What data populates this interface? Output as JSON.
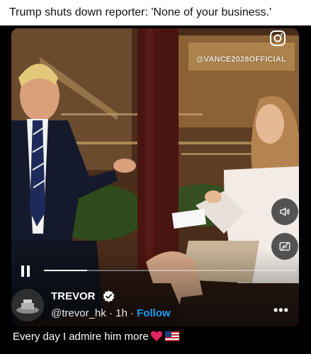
{
  "post": {
    "title": "Trump shuts down reporter: 'None of your business.'",
    "caption": "Every day I admire him more"
  },
  "video": {
    "watermark": "@VANCE2028OFFICIAL",
    "progress_fraction": 0.17,
    "controls": {
      "pause_icon": "pause-icon",
      "volume_icon": "speaker-icon",
      "captions_icon": "closed-captions-icon"
    }
  },
  "author": {
    "name": "TREVOR",
    "handle": "@trevor_hk",
    "separator": "·",
    "age": "1h",
    "follow_label": "Follow",
    "verified": true
  },
  "colors": {
    "accent": "#1d9bf0",
    "heart": "#e0245e"
  },
  "icons": [
    "instagram-icon",
    "verified-badge-icon",
    "more-icon",
    "heart-icon",
    "us-flag-icon"
  ]
}
